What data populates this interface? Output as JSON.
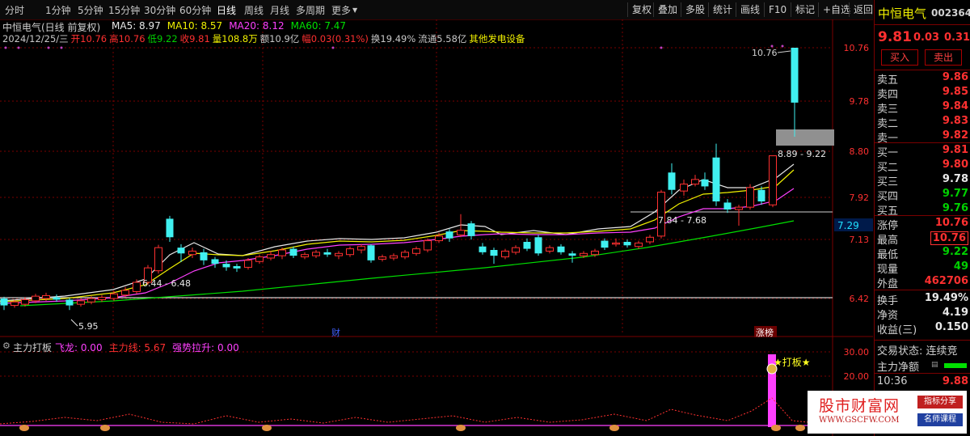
{
  "toolbar": {
    "tabs": [
      "分时",
      "1分钟",
      "5分钟",
      "15分钟",
      "30分钟",
      "60分钟",
      "日线",
      "周线",
      "月线",
      "多周期",
      "更多"
    ],
    "active_tab": "日线",
    "buttons": [
      "复权",
      "叠加",
      "多股",
      "统计",
      "画线",
      "F10",
      "标记",
      "+自选",
      "返回"
    ]
  },
  "main_chart": {
    "title": "中恒电气(日线 前复权)",
    "ma_labels": [
      {
        "text": "MA5: 8.97",
        "color": "#e8e8e8"
      },
      {
        "text": "MA10: 8.57",
        "color": "#f0f000"
      },
      {
        "text": "MA20: 8.12",
        "color": "#ff40ff"
      },
      {
        "text": "MA60: 7.47",
        "color": "#00e000"
      }
    ],
    "info_line": [
      {
        "text": "2024/12/25/三",
        "color": "#c8c8c8"
      },
      {
        "text": "开10.76",
        "color": "#ff3030"
      },
      {
        "text": "高10.76",
        "color": "#ff3030"
      },
      {
        "text": "低9.22",
        "color": "#00d000"
      },
      {
        "text": "收9.81",
        "color": "#ff3030"
      },
      {
        "text": "量108.8万",
        "color": "#f0f000"
      },
      {
        "text": "额10.9亿",
        "color": "#c8c8c8"
      },
      {
        "text": "幅0.03(0.31%)",
        "color": "#ff3030"
      },
      {
        "text": "换19.49%",
        "color": "#c8c8c8"
      },
      {
        "text": "流通5.58亿",
        "color": "#c8c8c8"
      },
      {
        "text": "其他发电设备",
        "color": "#f0f000"
      }
    ],
    "y_ticks": [
      "10.76",
      "9.78",
      "8.80",
      "7.92",
      "7.13",
      "6.42"
    ],
    "current_price_tag": "7.29",
    "annotations": {
      "high_label": "10.76",
      "range_label": "8.89 - 9.22",
      "range_label2": "7.84 - 7.68",
      "range_label3": "6.44 - 6.48",
      "low_label": "5.95",
      "marker_cai": "财",
      "marker_zhangbang": "涨榜"
    }
  },
  "indicator": {
    "name": "主力打板",
    "labels": [
      {
        "text": "飞龙: 0.00",
        "color": "#ff40ff"
      },
      {
        "text": "主力线: 5.67",
        "color": "#ff3030"
      },
      {
        "text": "强势拉升: 0.00",
        "color": "#ff40ff"
      }
    ],
    "y_ticks": [
      "30.00",
      "20.00"
    ],
    "signal_label": "★打板★"
  },
  "quote_panel": {
    "name": "中恒电气",
    "code": "002364",
    "price": "9.81",
    "change": "0.03",
    "change_pct": "0.31%",
    "buy_button": "买入",
    "sell_button": "卖出",
    "asks": [
      {
        "label": "卖五",
        "price": "9.86"
      },
      {
        "label": "卖四",
        "price": "9.85"
      },
      {
        "label": "卖三",
        "price": "9.84"
      },
      {
        "label": "卖二",
        "price": "9.83"
      },
      {
        "label": "卖一",
        "price": "9.82"
      }
    ],
    "bids": [
      {
        "label": "买一",
        "price": "9.81"
      },
      {
        "label": "买二",
        "price": "9.80"
      },
      {
        "label": "买三",
        "price": "9.78"
      },
      {
        "label": "买四",
        "price": "9.77"
      },
      {
        "label": "买五",
        "price": "9.76"
      }
    ],
    "stats": [
      {
        "label": "涨停",
        "value": "10.76"
      },
      {
        "label": "最高",
        "value": "10.76"
      },
      {
        "label": "最低",
        "value": "9.22"
      },
      {
        "label": "现量",
        "value": "49"
      },
      {
        "label": "外盘",
        "value": "462706"
      },
      {
        "label": "换手",
        "value": "19.49%"
      },
      {
        "label": "净资",
        "value": "4.19"
      },
      {
        "label": "收益(三)",
        "value": "0.150"
      }
    ],
    "trade_status": "交易状态: 连续竞",
    "main_net": "主力净额",
    "time": "10:36",
    "time_price": "9.88"
  },
  "watermark": {
    "title": "股市财富网",
    "url": "WWW.GSCFW.COM",
    "tag1": "指标分享",
    "tag2": "名师课程"
  },
  "colors": {
    "up": "#ff3030",
    "down": "#00ffff",
    "ma5": "#e8e8e8",
    "ma10": "#f0f000",
    "ma20": "#ff40ff",
    "ma60": "#00e000",
    "grid": "#7a0000"
  }
}
